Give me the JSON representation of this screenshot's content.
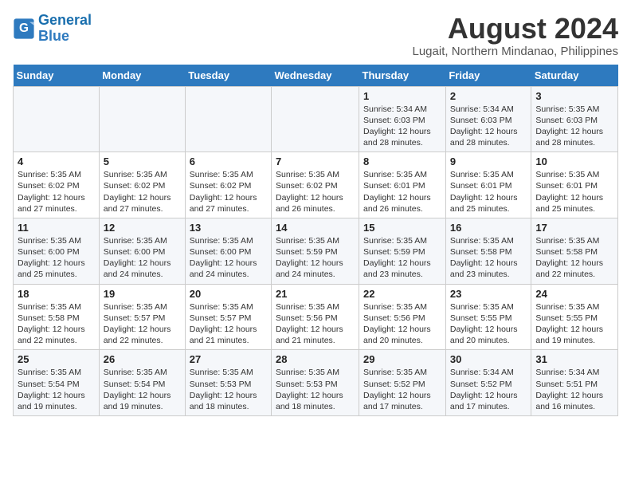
{
  "logo": {
    "line1": "General",
    "line2": "Blue"
  },
  "title": "August 2024",
  "location": "Lugait, Northern Mindanao, Philippines",
  "weekdays": [
    "Sunday",
    "Monday",
    "Tuesday",
    "Wednesday",
    "Thursday",
    "Friday",
    "Saturday"
  ],
  "weeks": [
    [
      {
        "day": "",
        "info": ""
      },
      {
        "day": "",
        "info": ""
      },
      {
        "day": "",
        "info": ""
      },
      {
        "day": "",
        "info": ""
      },
      {
        "day": "1",
        "info": "Sunrise: 5:34 AM\nSunset: 6:03 PM\nDaylight: 12 hours and 28 minutes."
      },
      {
        "day": "2",
        "info": "Sunrise: 5:34 AM\nSunset: 6:03 PM\nDaylight: 12 hours and 28 minutes."
      },
      {
        "day": "3",
        "info": "Sunrise: 5:35 AM\nSunset: 6:03 PM\nDaylight: 12 hours and 28 minutes."
      }
    ],
    [
      {
        "day": "4",
        "info": "Sunrise: 5:35 AM\nSunset: 6:02 PM\nDaylight: 12 hours and 27 minutes."
      },
      {
        "day": "5",
        "info": "Sunrise: 5:35 AM\nSunset: 6:02 PM\nDaylight: 12 hours and 27 minutes."
      },
      {
        "day": "6",
        "info": "Sunrise: 5:35 AM\nSunset: 6:02 PM\nDaylight: 12 hours and 27 minutes."
      },
      {
        "day": "7",
        "info": "Sunrise: 5:35 AM\nSunset: 6:02 PM\nDaylight: 12 hours and 26 minutes."
      },
      {
        "day": "8",
        "info": "Sunrise: 5:35 AM\nSunset: 6:01 PM\nDaylight: 12 hours and 26 minutes."
      },
      {
        "day": "9",
        "info": "Sunrise: 5:35 AM\nSunset: 6:01 PM\nDaylight: 12 hours and 25 minutes."
      },
      {
        "day": "10",
        "info": "Sunrise: 5:35 AM\nSunset: 6:01 PM\nDaylight: 12 hours and 25 minutes."
      }
    ],
    [
      {
        "day": "11",
        "info": "Sunrise: 5:35 AM\nSunset: 6:00 PM\nDaylight: 12 hours and 25 minutes."
      },
      {
        "day": "12",
        "info": "Sunrise: 5:35 AM\nSunset: 6:00 PM\nDaylight: 12 hours and 24 minutes."
      },
      {
        "day": "13",
        "info": "Sunrise: 5:35 AM\nSunset: 6:00 PM\nDaylight: 12 hours and 24 minutes."
      },
      {
        "day": "14",
        "info": "Sunrise: 5:35 AM\nSunset: 5:59 PM\nDaylight: 12 hours and 24 minutes."
      },
      {
        "day": "15",
        "info": "Sunrise: 5:35 AM\nSunset: 5:59 PM\nDaylight: 12 hours and 23 minutes."
      },
      {
        "day": "16",
        "info": "Sunrise: 5:35 AM\nSunset: 5:58 PM\nDaylight: 12 hours and 23 minutes."
      },
      {
        "day": "17",
        "info": "Sunrise: 5:35 AM\nSunset: 5:58 PM\nDaylight: 12 hours and 22 minutes."
      }
    ],
    [
      {
        "day": "18",
        "info": "Sunrise: 5:35 AM\nSunset: 5:58 PM\nDaylight: 12 hours and 22 minutes."
      },
      {
        "day": "19",
        "info": "Sunrise: 5:35 AM\nSunset: 5:57 PM\nDaylight: 12 hours and 22 minutes."
      },
      {
        "day": "20",
        "info": "Sunrise: 5:35 AM\nSunset: 5:57 PM\nDaylight: 12 hours and 21 minutes."
      },
      {
        "day": "21",
        "info": "Sunrise: 5:35 AM\nSunset: 5:56 PM\nDaylight: 12 hours and 21 minutes."
      },
      {
        "day": "22",
        "info": "Sunrise: 5:35 AM\nSunset: 5:56 PM\nDaylight: 12 hours and 20 minutes."
      },
      {
        "day": "23",
        "info": "Sunrise: 5:35 AM\nSunset: 5:55 PM\nDaylight: 12 hours and 20 minutes."
      },
      {
        "day": "24",
        "info": "Sunrise: 5:35 AM\nSunset: 5:55 PM\nDaylight: 12 hours and 19 minutes."
      }
    ],
    [
      {
        "day": "25",
        "info": "Sunrise: 5:35 AM\nSunset: 5:54 PM\nDaylight: 12 hours and 19 minutes."
      },
      {
        "day": "26",
        "info": "Sunrise: 5:35 AM\nSunset: 5:54 PM\nDaylight: 12 hours and 19 minutes."
      },
      {
        "day": "27",
        "info": "Sunrise: 5:35 AM\nSunset: 5:53 PM\nDaylight: 12 hours and 18 minutes."
      },
      {
        "day": "28",
        "info": "Sunrise: 5:35 AM\nSunset: 5:53 PM\nDaylight: 12 hours and 18 minutes."
      },
      {
        "day": "29",
        "info": "Sunrise: 5:35 AM\nSunset: 5:52 PM\nDaylight: 12 hours and 17 minutes."
      },
      {
        "day": "30",
        "info": "Sunrise: 5:34 AM\nSunset: 5:52 PM\nDaylight: 12 hours and 17 minutes."
      },
      {
        "day": "31",
        "info": "Sunrise: 5:34 AM\nSunset: 5:51 PM\nDaylight: 12 hours and 16 minutes."
      }
    ]
  ]
}
